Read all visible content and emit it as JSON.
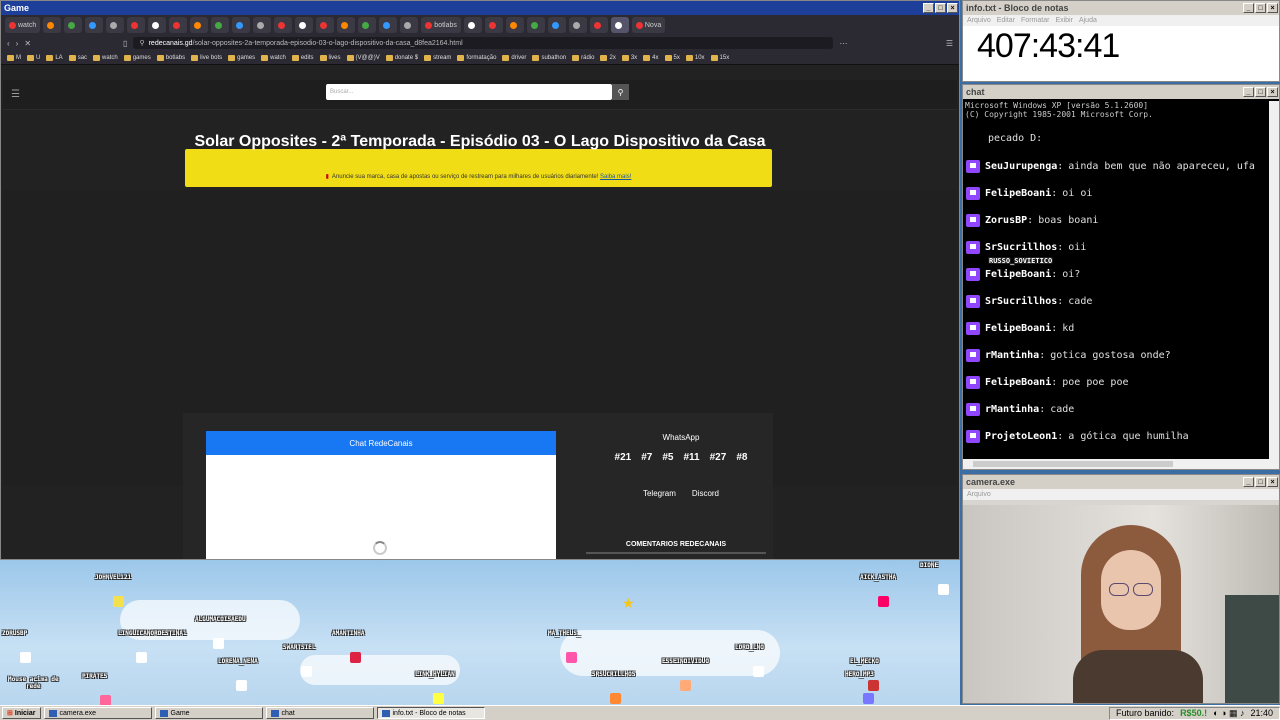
{
  "game_window": {
    "title": "Game",
    "browser": {
      "tabs": [
        "watch",
        "",
        "",
        "",
        "",
        "",
        "",
        "",
        "",
        "",
        "",
        "",
        "",
        "",
        "",
        "",
        "",
        "",
        "",
        "botlabs",
        "",
        "",
        "",
        "",
        "",
        "",
        "",
        "",
        "Nova"
      ],
      "url_domain": "redecanais.gd",
      "url_path": "/solar-opposites-2a-temporada-episodio-03-o-lago-dispositivo-da-casa_d8fea2164.html",
      "bookmarks": [
        "M",
        "U",
        "LA",
        "sac",
        "watch",
        "games",
        "botlabs",
        "live bots",
        "games",
        "watch",
        "edits",
        "lives",
        "(V@@)V",
        "donate $",
        "stream",
        "formatação",
        "driver",
        "subathon",
        "rádio",
        "2x",
        "3x",
        "4x",
        "5x",
        "10x",
        "15x"
      ]
    },
    "site": {
      "search_placeholder": "Buscar...",
      "page_title": "Solar Opposites - 2ª Temporada - Episódio 03 - O Lago Dispositivo da Casa",
      "ad_text": "Anuncie sua marca, casa de apostas ou serviço de restream para milhares de usuários diariamente!",
      "ad_link": "Saiba mais!",
      "chat_header": "Chat RedeCanais",
      "whatsapp_label": "WhatsApp",
      "group_numbers": [
        "#21",
        "#7",
        "#5",
        "#11",
        "#27",
        "#8"
      ],
      "telegram_label": "Telegram",
      "discord_label": "Discord",
      "comments_label": "COMENTARIOS REDECANAIS"
    }
  },
  "stream_overlay": {
    "usernames": [
      "JOHNVEL121",
      "AICK_ASTHA",
      "DIONE",
      "ALGUMACOISAEDU",
      "ZORUSBP",
      "LINGUICANORDESTINA1",
      "AMANTINHA",
      "MA_THEUS_",
      "SWARTSIEL",
      "LORENA_NENA",
      "LORD_LNO",
      "EL_MECKO",
      "HERO_MP3",
      "PIRATES",
      "LINK_HYLIAN",
      "SRSUCRILLHOS",
      "ESSEINDIVIDUO"
    ],
    "mouse_label": "Mouse acima de\nrede"
  },
  "notepad": {
    "title": "info.txt - Bloco de notas",
    "menu": [
      "Arquivo",
      "Editar",
      "Formatar",
      "Exibir",
      "Ajuda"
    ],
    "timer": "407:43:41"
  },
  "chat_window": {
    "title": "chat",
    "console_header": [
      "Microsoft Windows XP [versão 5.1.2600]",
      "(C) Copyright 1985-2001 Microsoft Corp."
    ],
    "messages": [
      {
        "user": "",
        "text": "pecado D:"
      },
      {
        "user": "SeuJurupenga",
        "text": "ainda bem que não apareceu, ufa"
      },
      {
        "user": "FelipeBoani",
        "text": "oi oi"
      },
      {
        "user": "ZorusBP",
        "text": "boas boani"
      },
      {
        "user": "SrSucrillhos",
        "text": "oii"
      },
      {
        "user": "FelipeBoani",
        "text": "oi?"
      },
      {
        "user": "SrSucrillhos",
        "text": "cade"
      },
      {
        "user": "FelipeBoani",
        "text": "kd"
      },
      {
        "user": "rMantinha",
        "text": "gotica gostosa onde?"
      },
      {
        "user": "FelipeBoani",
        "text": "poe poe poe"
      },
      {
        "user": "rMantinha",
        "text": "cade"
      },
      {
        "user": "ProjetoLeon1",
        "text": "a gótica que humilha"
      }
    ],
    "overlay_name": "RUSSO_SOVIETICO"
  },
  "camera_window": {
    "title": "camera.exe",
    "menu": [
      "Arquivo"
    ]
  },
  "taskbar": {
    "start_label": "Iniciar",
    "tasks": [
      "camera.exe",
      "Game",
      "chat",
      "info.txt - Bloco de notas"
    ],
    "tray_text": "Futuro banido:",
    "tray_money": "R$50.!",
    "clock": "21:40"
  },
  "colors": {
    "xp_title_active": "#1d3f9a",
    "ad_yellow": "#f1dd16",
    "chat_blue": "#1877f2",
    "twitch_purple": "#9147ff",
    "desktop_blue": "#3a6ea5"
  }
}
